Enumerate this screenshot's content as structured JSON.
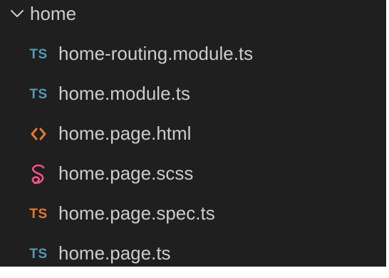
{
  "folder": {
    "name": "home",
    "expanded": true,
    "chevron_icon": "chevron-down-icon"
  },
  "files": [
    {
      "label": "home-routing.module.ts",
      "icon": "typescript-icon",
      "icon_text": "TS",
      "icon_color": "#519aba"
    },
    {
      "label": "home.module.ts",
      "icon": "typescript-icon",
      "icon_text": "TS",
      "icon_color": "#519aba"
    },
    {
      "label": "home.page.html",
      "icon": "html-icon",
      "icon_text": "",
      "icon_color": "#e37933"
    },
    {
      "label": "home.page.scss",
      "icon": "sass-icon",
      "icon_text": "",
      "icon_color": "#f55385"
    },
    {
      "label": "home.page.spec.ts",
      "icon": "typescript-spec-icon",
      "icon_text": "TS",
      "icon_color": "#e37933"
    },
    {
      "label": "home.page.ts",
      "icon": "typescript-icon",
      "icon_text": "TS",
      "icon_color": "#519aba"
    }
  ],
  "colors": {
    "background": "#1f1f1f",
    "text": "#cccccc"
  }
}
